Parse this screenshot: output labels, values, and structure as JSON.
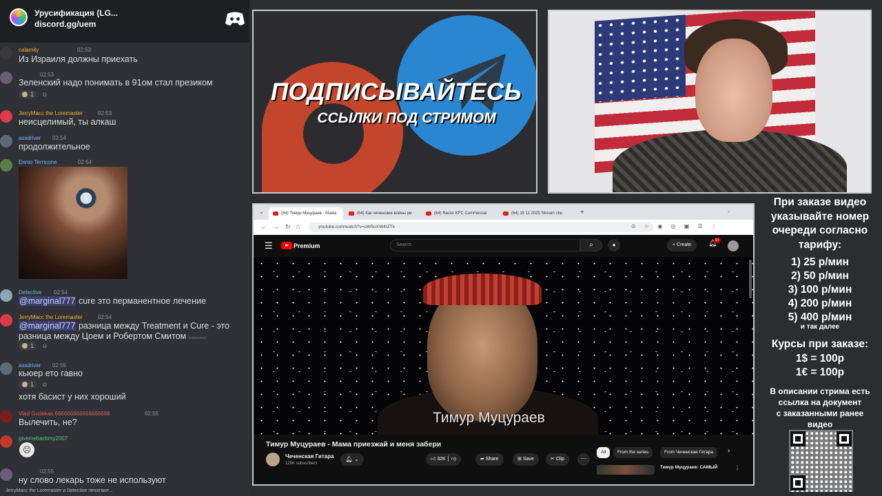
{
  "discord": {
    "server_name": "Урусификация (LG...",
    "server_link": "discord.gg/uem",
    "messages": [
      {
        "author": "calamity",
        "time": "02:53",
        "text": "Из Израиля должны приехать",
        "author_color": "#f0b232"
      },
      {
        "author": "",
        "time": "02:53",
        "text": "Зеленский надо понимать в 91ом стал презиком",
        "author_color": "#b9bbbe",
        "reaction_count": "1"
      },
      {
        "author": "JerryMacc the Loremaster",
        "time": "02:53",
        "text": "неисцелимый, ты алкаш",
        "author_color": "#f0b232"
      },
      {
        "author": "assdriver",
        "time": "02:54",
        "text": "продолжительное",
        "author_color": "#7fb3ff"
      },
      {
        "author": "Ennio Terricone",
        "time": "02:54",
        "text": "",
        "author_color": "#7fb3ff"
      },
      {
        "author": "Detective",
        "time": "02:54",
        "mention": "@marginal777",
        "text": " cure это перманентное лечение",
        "author_color": "#5fc1e0"
      },
      {
        "author": "JerryMacc the Loremaster",
        "time": "02:54",
        "mention": "@marginal777",
        "text": " разница между Treatment и Cure - это разница между Цоем и Робертом Смитом",
        "edited": "(изменено)",
        "author_color": "#f0b232",
        "reaction_count": "1"
      },
      {
        "author": "assdriver",
        "time": "02:55",
        "text": "кьюер ето гавно",
        "author_color": "#7fb3ff",
        "reaction_count": "1"
      },
      {
        "author": "",
        "time": "",
        "text": "хотя басист у них хороший",
        "author_color": "#b9bbbe"
      },
      {
        "author": "Vlad Gudekas",
        "time": "02:55",
        "author_suffix": "666666666666666666",
        "text": "Вылечить, не?",
        "author_color": "#e05d5d"
      },
      {
        "author": "givemebackmy2007",
        "time": "",
        "text": "",
        "author_color": "#57c27c"
      },
      {
        "author": "",
        "time": "02:55",
        "text": "ну слово лекарь тоже не используют",
        "author_color": "#b9bbbe"
      }
    ],
    "typing": "JerryMacc the Loremaster и Detective печатают..."
  },
  "banner": {
    "title": "ПОДПИСЫВАЙТЕСЬ",
    "subtitle": "ССЫЛКИ ПОД СТРИМОМ"
  },
  "browser": {
    "tabs": [
      {
        "title": "(64) Тимур Муцураев - Мама"
      },
      {
        "title": "(64) Как чеченские войны ум"
      },
      {
        "title": "(64) Racist KFC Commercial"
      },
      {
        "title": "(64) 15 11 2025 Stream chu"
      }
    ],
    "url": "youtube.com/watch?v=uW5oXW4rZTk"
  },
  "youtube": {
    "brand": "Premium",
    "search_placeholder": "Search",
    "create_label": "Create",
    "notification_count": "9+",
    "video_caption": "Тимур Муцураев",
    "video_title": "Тимур Муцураев - Мама приезжай и меня забери",
    "channel_name": "Чеченская Гитара",
    "channel_subs": "125K subscribers",
    "likes": "32K",
    "share_label": "Share",
    "save_label": "Save",
    "clip_label": "Clip",
    "chips": [
      "All",
      "From the series",
      "From Чеченская Гитара"
    ],
    "rec_title": "Тимур Муцураев: САМЫЙ"
  },
  "prices": {
    "intro_lines": [
      "При заказе видео",
      "указывайте номер",
      "очереди согласно",
      "тарифу:"
    ],
    "tiers": [
      "1) 25 р/мин",
      "2) 50 р/мин",
      "3) 100 р/мин",
      "4) 200 р/мин",
      "5) 400 р/мин"
    ],
    "tiers_note": "и так далее",
    "rates_title": "Курсы при заказе:",
    "rates": [
      "1$ = 100р",
      "1€ = 100р"
    ],
    "note_lines": [
      "В описании стрима есть",
      "ссылка на документ",
      "с заказанными ранее",
      "видео"
    ]
  },
  "colors": {
    "discord_bg": "#2f3136",
    "youtube_red": "#ff0000",
    "telegram_blue": "#2a86d1",
    "patreon_orange": "#c2452c"
  }
}
